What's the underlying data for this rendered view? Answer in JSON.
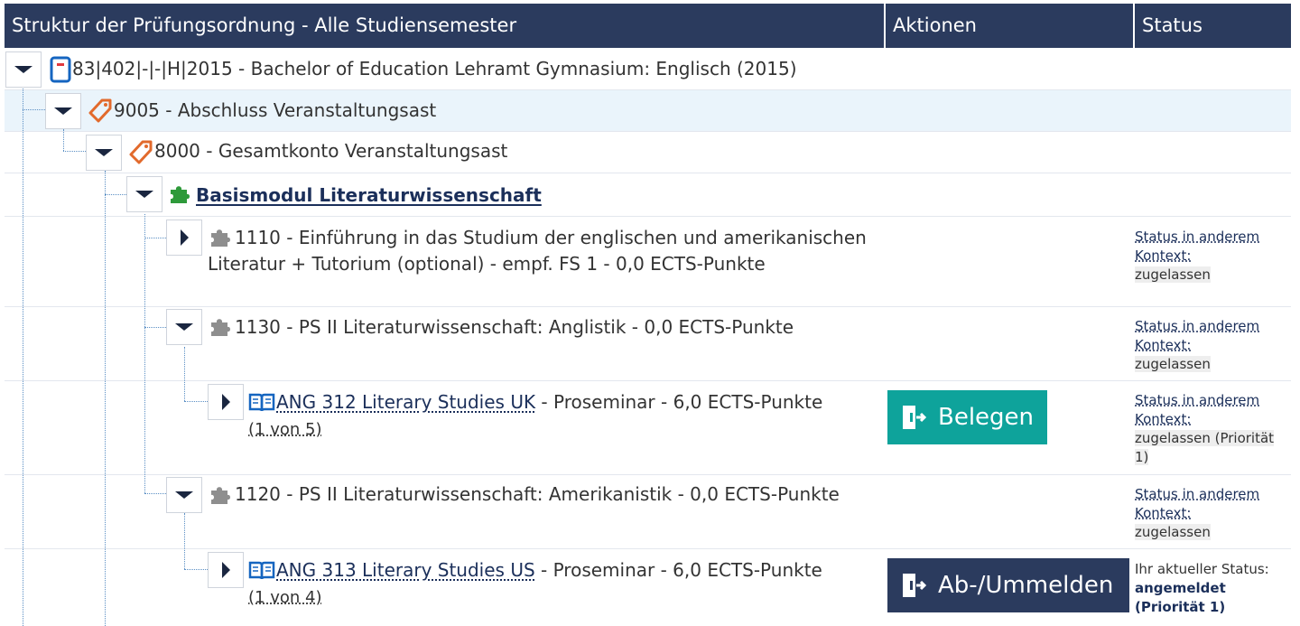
{
  "header": {
    "col_structure": "Struktur der Prüfungsordnung - Alle Studiensemester",
    "col_actions": "Aktionen",
    "col_status": "Status"
  },
  "rows": {
    "root": {
      "label": "83|402|-|-|H|2015 - Bachelor of Education Lehramt Gymnasium: Englisch (2015)"
    },
    "r9005": {
      "label": "9005 - Abschluss Veranstaltungsast"
    },
    "r8000": {
      "label": "8000 - Gesamtkonto Veranstaltungsast"
    },
    "basis": {
      "label": "Basismodul Literaturwissenschaft"
    },
    "r1110": {
      "label": "1110 - Einführung in das Studium der englischen und amerikanischen Literatur + Tutorium (optional) - empf. FS 1 - 0,0 ECTS-Punkte"
    },
    "r1130": {
      "label": "1130 - PS II Literaturwissenschaft: Anglistik - 0,0 ECTS-Punkte"
    },
    "ang312": {
      "title": "ANG 312 Literary Studies UK",
      "desc": " - Proseminar - 6,0 ECTS-Punkte",
      "parallel": "(1 von 5)",
      "action": "Belegen"
    },
    "r1120": {
      "label": "1120 - PS II Literaturwissenschaft: Amerikanistik - 0,0 ECTS-Punkte"
    },
    "ang313": {
      "title": "ANG 313 Literary Studies US",
      "desc": " - Proseminar - 6,0 ECTS-Punkte",
      "parallel": "(1 von 4)",
      "action": "Ab-/Ummelden"
    }
  },
  "status": {
    "other_context": "Status in anderem Kontext:",
    "admitted": "zugelassen",
    "admitted_prio": "zugelassen (Priorität 1)",
    "current": "Ihr aktueller Status:",
    "registered": "angemeldet (Priorität 1)"
  },
  "colors": {
    "header_bg": "#2b3b5e",
    "teal_button": "#0ea39b",
    "navy_button": "#2b3b5e",
    "selected_row": "#eaf4fb"
  }
}
